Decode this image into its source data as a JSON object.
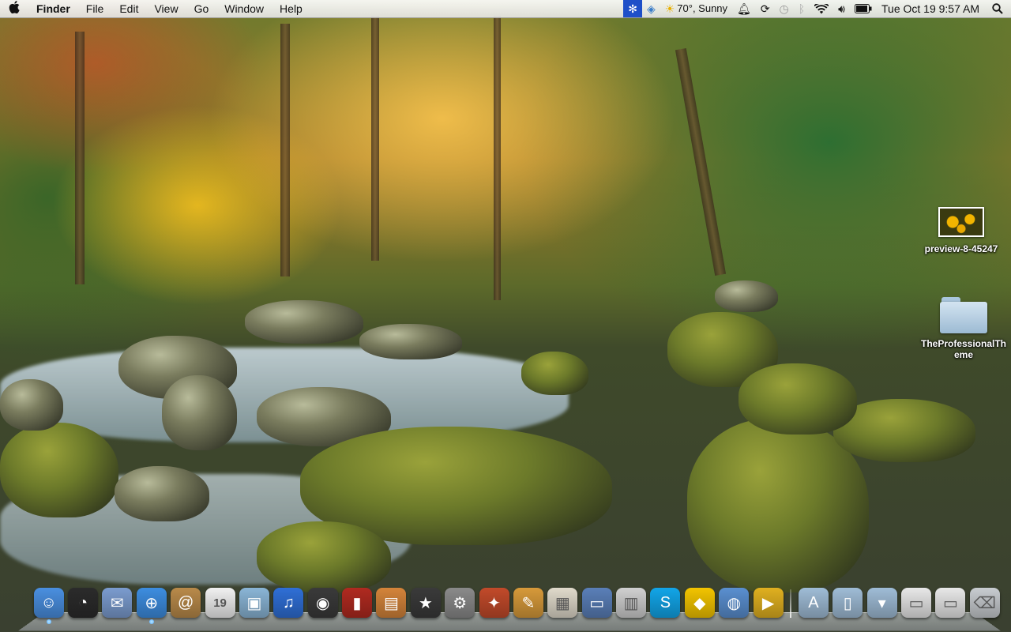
{
  "menubar": {
    "apple_icon": "apple-icon",
    "app_name": "Finder",
    "menus": [
      "File",
      "Edit",
      "View",
      "Go",
      "Window",
      "Help"
    ],
    "status": {
      "weather": "70°, Sunny",
      "clock": "Tue Oct 19  9:57 AM"
    }
  },
  "desktop": {
    "icons": [
      {
        "label": "preview-8-45247",
        "kind": "image"
      },
      {
        "label": "TheProfessionalTheme",
        "kind": "folder"
      }
    ]
  },
  "dock": {
    "apps": [
      {
        "name": "Finder",
        "icon": "finder-icon",
        "color": "#4a8fe0",
        "running": true
      },
      {
        "name": "Dashboard",
        "icon": "dashboard-icon",
        "color": "#2b2b2b",
        "running": false
      },
      {
        "name": "Mail",
        "icon": "mail-icon",
        "color": "#7b9ccf",
        "running": false
      },
      {
        "name": "Safari",
        "icon": "safari-icon",
        "color": "#3d8de0",
        "running": true
      },
      {
        "name": "Address Book",
        "icon": "address-book-icon",
        "color": "#b98a4a",
        "running": false
      },
      {
        "name": "iCal",
        "icon": "calendar-icon",
        "color": "#f1f1f1",
        "running": false
      },
      {
        "name": "iPhoto",
        "icon": "iphoto-icon",
        "color": "#8ab5d6",
        "running": false
      },
      {
        "name": "iTunes",
        "icon": "itunes-icon",
        "color": "#2f6fd6",
        "running": false
      },
      {
        "name": "Camera",
        "icon": "camera-icon",
        "color": "#3a3a3a",
        "running": false
      },
      {
        "name": "Front Row",
        "icon": "front-row-icon",
        "color": "#b02a20",
        "running": false
      },
      {
        "name": "Image Capture",
        "icon": "image-capture-icon",
        "color": "#d4843a",
        "running": false
      },
      {
        "name": "iMovie",
        "icon": "star-icon",
        "color": "#3a3a3a",
        "running": false
      },
      {
        "name": "System Preferences",
        "icon": "system-prefs-icon",
        "color": "#8a8a8a",
        "running": false
      },
      {
        "name": "Utilities",
        "icon": "utilities-icon",
        "color": "#c24a2a",
        "running": false
      },
      {
        "name": "Pages",
        "icon": "pages-icon",
        "color": "#d79a3a",
        "running": false
      },
      {
        "name": "Preview",
        "icon": "preview-icon",
        "color": "#e0dacb",
        "running": false
      },
      {
        "name": "Keynote",
        "icon": "keynote-icon",
        "color": "#5a7fb8",
        "running": false
      },
      {
        "name": "Photo Booth",
        "icon": "photo-booth-icon",
        "color": "#d0d0d0",
        "running": false
      },
      {
        "name": "Skype",
        "icon": "skype-icon",
        "color": "#12a5e8",
        "running": false
      },
      {
        "name": "Growl",
        "icon": "bird-icon",
        "color": "#f2c400",
        "running": false
      },
      {
        "name": "Network",
        "icon": "globe-icon",
        "color": "#5a8fd0",
        "running": false
      },
      {
        "name": "Transmit",
        "icon": "truck-icon",
        "color": "#e0b020",
        "running": false
      }
    ],
    "stacks": [
      {
        "name": "Applications",
        "icon": "applications-folder-icon",
        "color": "#9fbcd6"
      },
      {
        "name": "Documents",
        "icon": "documents-folder-icon",
        "color": "#9fbcd6"
      },
      {
        "name": "Downloads",
        "icon": "downloads-folder-icon",
        "color": "#9fbcd6"
      },
      {
        "name": "Window 1",
        "icon": "window-thumb-icon",
        "color": "#e8e8e8"
      },
      {
        "name": "Window 2",
        "icon": "window-thumb-icon",
        "color": "#e8e8e8"
      },
      {
        "name": "Trash",
        "icon": "trash-icon",
        "color": "#c8ccd0"
      }
    ]
  }
}
